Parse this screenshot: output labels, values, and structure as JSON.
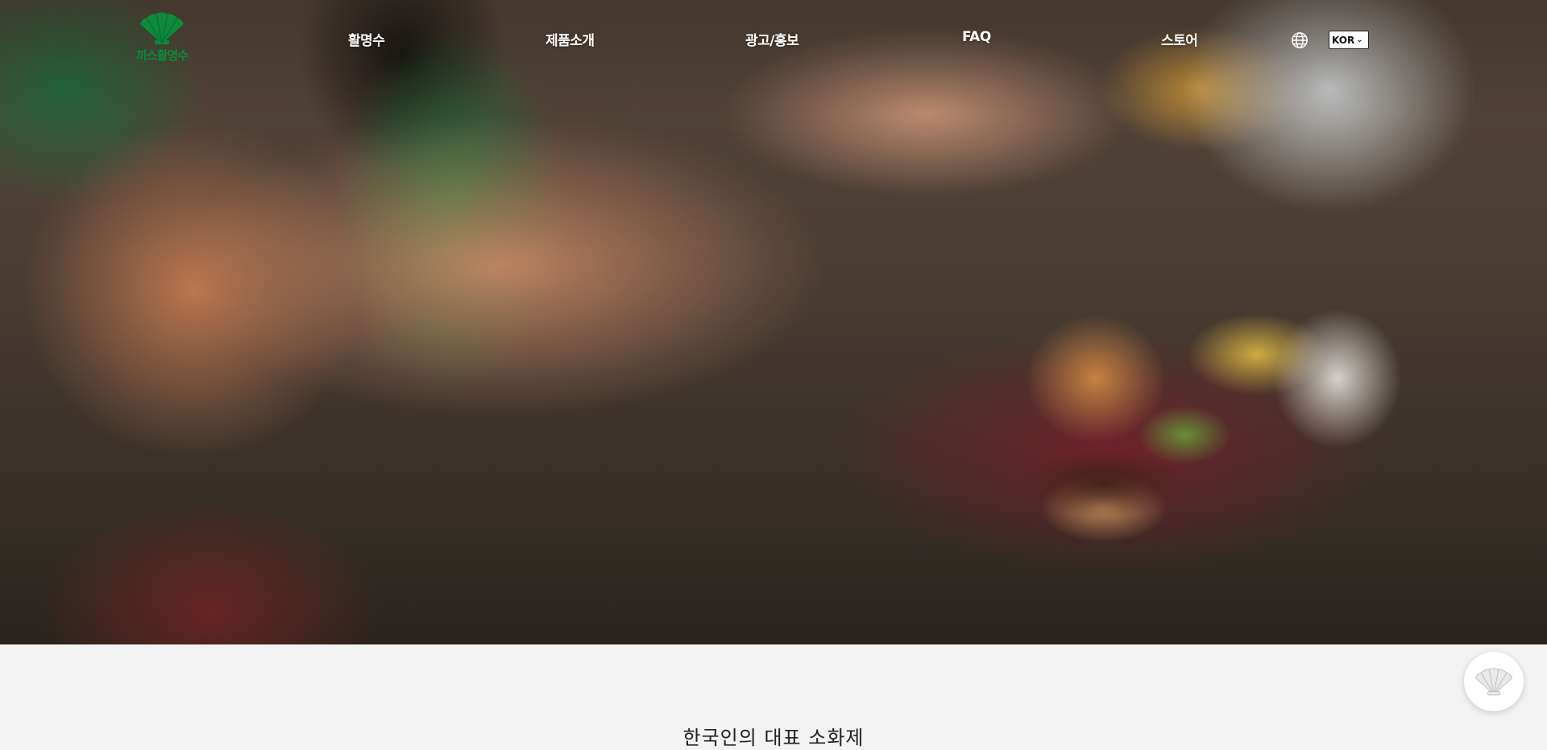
{
  "brand": {
    "logo_text": "까스활명수",
    "logo_icon": "fan-shell-logo-icon",
    "color": "#0d8a3c"
  },
  "nav": {
    "items": [
      {
        "label": "활명수"
      },
      {
        "label": "제품소개"
      },
      {
        "label": "광고/홍보"
      },
      {
        "label": "FAQ"
      },
      {
        "label": "스토어"
      }
    ]
  },
  "language": {
    "icon": "globe-icon",
    "selected": "KOR"
  },
  "hero": {
    "scene": "video-still"
  },
  "section": {
    "tagline": "한국인의 대표 소화제"
  },
  "floating_button": {
    "icon": "fan-shell-logo-icon"
  }
}
